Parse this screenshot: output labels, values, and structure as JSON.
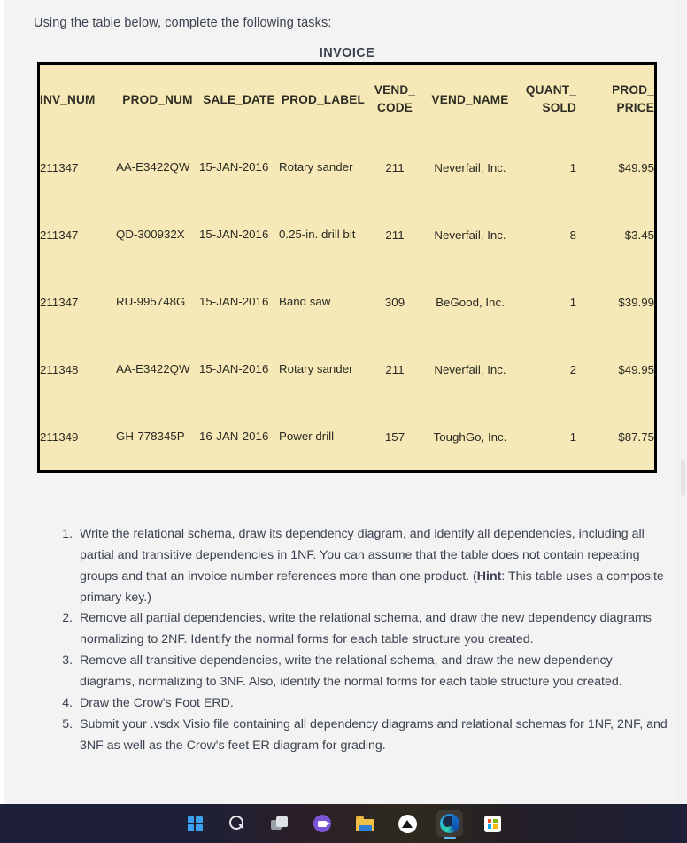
{
  "document": {
    "intro": "Using the table below, complete the following tasks:",
    "table_title": "INVOICE"
  },
  "invoice_table": {
    "headers": {
      "inv_num": "INV_NUM",
      "prod_num": "PROD_NUM",
      "sale_date": "SALE_DATE",
      "prod_label": "PROD_LABEL",
      "vend_code_l1": "VEND_",
      "vend_code_l2": "CODE",
      "vend_name": "VEND_NAME",
      "quant_sold_l1": "QUANT_",
      "quant_sold_l2": "SOLD",
      "prod_price_l1": "PROD_",
      "prod_price_l2": "PRICE"
    },
    "rows": [
      {
        "inv_num": "211347",
        "prod_num": "AA-E3422QW",
        "sale_date": "15-JAN-2016",
        "prod_label": "Rotary sander",
        "vend_code": "211",
        "vend_name": "Neverfail, Inc.",
        "quant_sold": "1",
        "prod_price": "$49.95"
      },
      {
        "inv_num": "211347",
        "prod_num": "QD-300932X",
        "sale_date": "15-JAN-2016",
        "prod_label": "0.25-in. drill bit",
        "vend_code": "211",
        "vend_name": "Neverfail, Inc.",
        "quant_sold": "8",
        "prod_price": "$3.45"
      },
      {
        "inv_num": "211347",
        "prod_num": "RU-995748G",
        "sale_date": "15-JAN-2016",
        "prod_label": "Band saw",
        "vend_code": "309",
        "vend_name": "BeGood, Inc.",
        "quant_sold": "1",
        "prod_price": "$39.99"
      },
      {
        "inv_num": "211348",
        "prod_num": "AA-E3422QW",
        "sale_date": "15-JAN-2016",
        "prod_label": "Rotary sander",
        "vend_code": "211",
        "vend_name": "Neverfail, Inc.",
        "quant_sold": "2",
        "prod_price": "$49.95"
      },
      {
        "inv_num": "211349",
        "prod_num": "GH-778345P",
        "sale_date": "16-JAN-2016",
        "prod_label": "Power drill",
        "vend_code": "157",
        "vend_name": "ToughGo, Inc.",
        "quant_sold": "1",
        "prod_price": "$87.75"
      }
    ]
  },
  "tasks": [
    {
      "part1": "Write the relational schema, draw its dependency diagram, and identify all dependencies, including all partial and transitive dependencies in 1NF. You can assume that the table does not contain repeating groups and that an invoice number references more than one product. (",
      "bold": "Hint",
      "part2": ": This table uses a composite primary key.)"
    },
    {
      "part1": "Remove all partial dependencies, write the relational schema, and draw the new dependency diagrams normalizing to 2NF. Identify the normal forms for each table structure you created.",
      "bold": "",
      "part2": ""
    },
    {
      "part1": "Remove all transitive dependencies, write the relational schema, and draw the new dependency diagrams, normalizing to 3NF. Also, identify the normal forms for each table structure you created.",
      "bold": "",
      "part2": ""
    },
    {
      "part1": "Draw the Crow's Foot ERD.",
      "bold": "",
      "part2": ""
    },
    {
      "part1": "Submit your .vsdx Visio file containing all dependency diagrams and relational schemas for 1NF, 2NF, and 3NF as well as the Crow's feet ER diagram for grading.",
      "bold": "",
      "part2": ""
    }
  ],
  "taskbar": {
    "items": [
      {
        "name": "start-icon",
        "label": "Start"
      },
      {
        "name": "search-icon",
        "label": "Search"
      },
      {
        "name": "task-view-icon",
        "label": "Task View"
      },
      {
        "name": "chat-icon",
        "label": "Chat"
      },
      {
        "name": "file-explorer-icon",
        "label": "File Explorer"
      },
      {
        "name": "app-icon",
        "label": "App"
      },
      {
        "name": "edge-icon",
        "label": "Microsoft Edge"
      },
      {
        "name": "store-icon",
        "label": "Microsoft Store"
      }
    ]
  },
  "colors": {
    "table_fill": "#F7E9B7",
    "table_border": "#000000",
    "page_bg": "#F3F3F3",
    "text": "#3B4350",
    "taskbar_bg": "#1D2038",
    "edge_active_indicator": "#63B6F0"
  }
}
